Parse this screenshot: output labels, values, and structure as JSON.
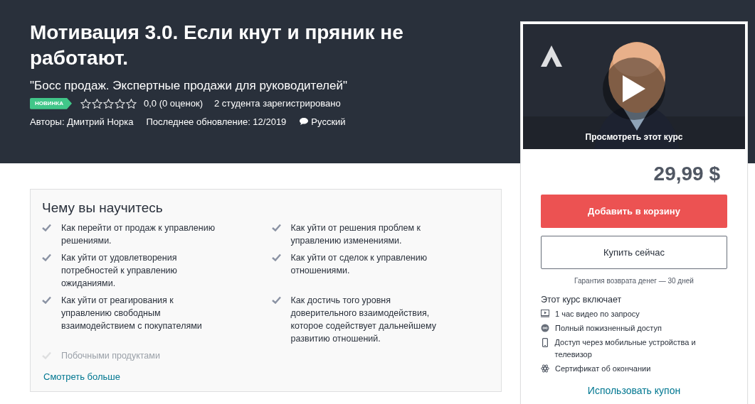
{
  "header": {
    "title": "Мотивация 3.0. Если кнут и пряник не работают.",
    "subtitle": "\"Босс продаж. Экспертные продажи для руководителей\"",
    "badge": "НОВИНКА",
    "stars": 0,
    "rating": "0,0 (0 оценок)",
    "students": "2 студента зарегистрировано",
    "authors_label": "Авторы:",
    "author": "Дмитрий Норка",
    "updated": "Последнее обновление: 12/2019",
    "language": "Русский"
  },
  "learn": {
    "title": "Чему вы научитесь",
    "items": [
      {
        "text": "Как перейти от продаж к управлению решениями."
      },
      {
        "text": "Как уйти от решения проблем к управлению изменениями."
      },
      {
        "text": "Как уйти от удовлетворения потребностей к управлению ожиданиями."
      },
      {
        "text": "Как уйти от сделок к управлению отношениями."
      },
      {
        "text": "Как уйти от реагирования к управлению свободным взаимодействием с покупателями"
      },
      {
        "text": "Как достичь того уровня доверительного взаимодействия, которое содействует дальнейшему развитию отношений."
      },
      {
        "text": "Побочными продуктами",
        "faded": true
      }
    ],
    "more_link": "Смотреть больше"
  },
  "sidebar": {
    "preview": {
      "kind": "picture",
      "caption": "Просмотреть этот курс"
    },
    "price": "29,99 $",
    "add_to_cart": "Добавить в корзину",
    "buy_now": "Купить сейчас",
    "guarantee": "Гарантия возврата денег — 30 дней",
    "includes_title": "Этот курс включает",
    "includes": [
      {
        "kind": "video",
        "text": "1 час видео по запросу"
      },
      {
        "kind": "lifetime",
        "text": "Полный пожизненный доступ"
      },
      {
        "kind": "mobile",
        "text": "Доступ через мобильные устройства и телевизор"
      },
      {
        "kind": "certificate",
        "text": "Сертификат об окончании"
      }
    ],
    "coupon": "Использовать купон"
  }
}
